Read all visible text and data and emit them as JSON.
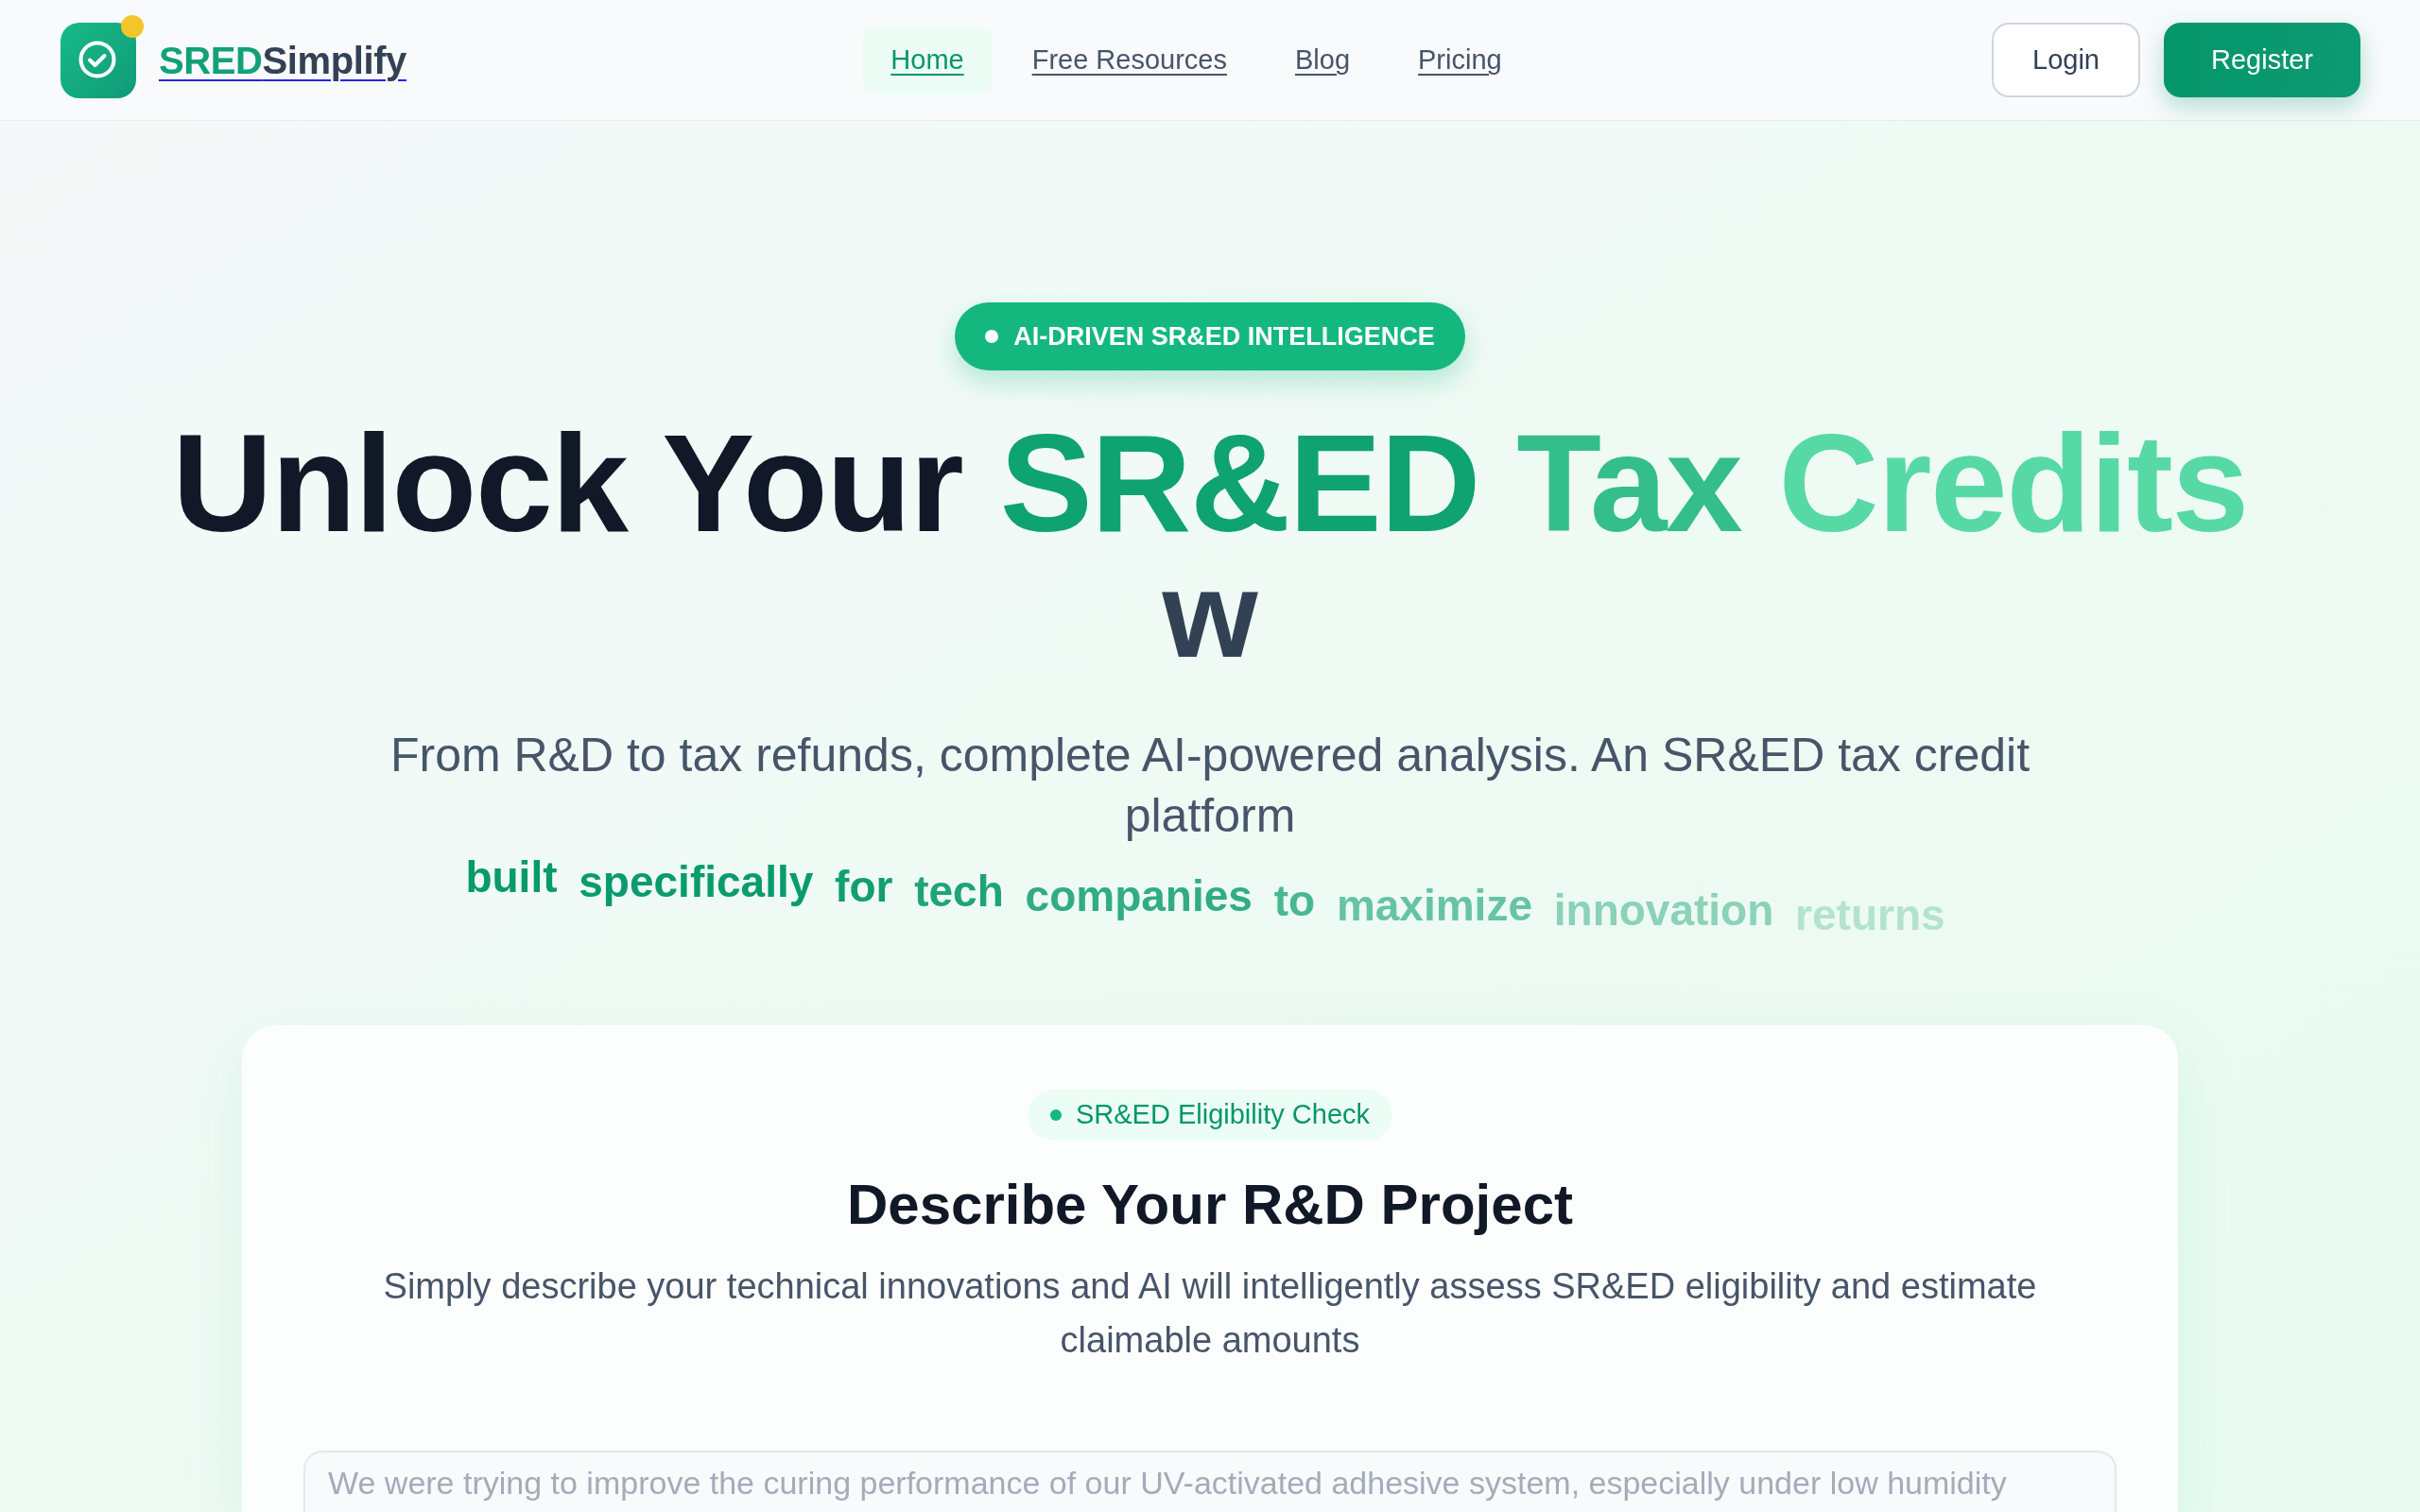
{
  "header": {
    "logo": {
      "prefix": "SRED",
      "suffix": "Simplify"
    },
    "nav": [
      {
        "label": "Home",
        "selected": true
      },
      {
        "label": "Free Resources",
        "selected": false
      },
      {
        "label": "Blog",
        "selected": false
      },
      {
        "label": "Pricing",
        "selected": false
      }
    ],
    "actions": [
      {
        "label": "Login",
        "kind": "outline"
      },
      {
        "label": "Register",
        "kind": "primary"
      }
    ]
  },
  "hero": {
    "badge": "AI-DRIVEN SR&ED INTELLIGENCE",
    "title": {
      "lead": "Unlock Your",
      "highlight": "SR&ED Tax Credits"
    },
    "typing_text": "w",
    "subtitle": "From R&D to tax refunds, complete AI-powered analysis. An SR&ED tax credit platform",
    "tagline": "built specifically for tech companies to maximize innovation returns"
  },
  "card": {
    "badge": "SR&ED Eligibility Check",
    "heading": "Describe Your R&D Project",
    "description": "Simply describe your technical innovations and AI will intelligently assess SR&ED eligibility and estimate claimable amounts",
    "project_field": {
      "placeholder": "We were trying to improve the curing performance of our UV-activated adhesive system, especially under low humidity"
    }
  }
}
